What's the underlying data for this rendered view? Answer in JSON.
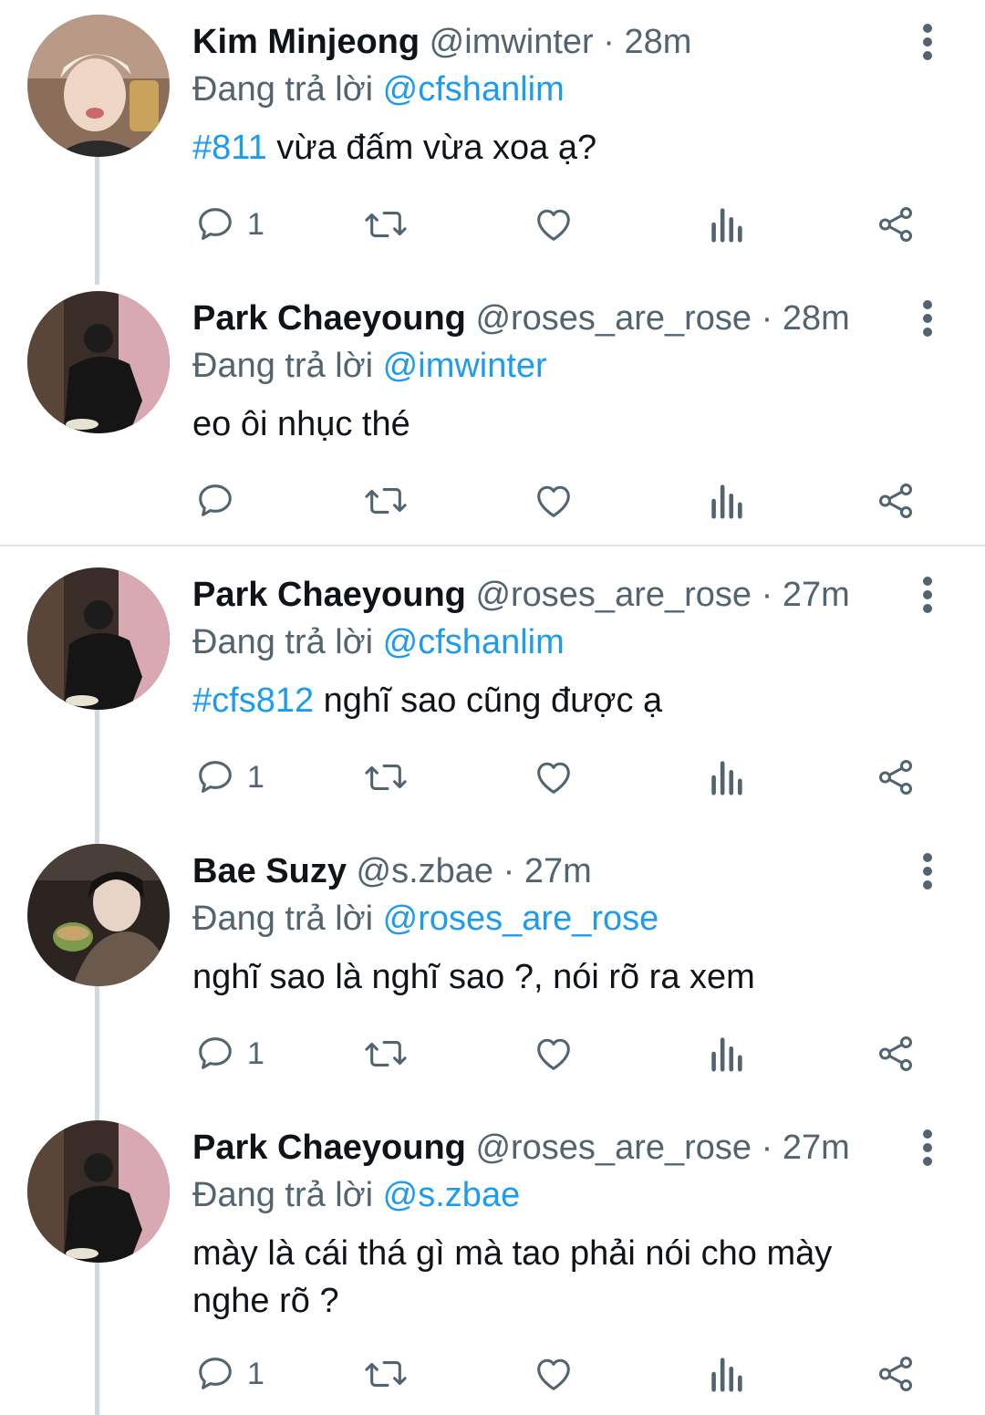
{
  "tweets": [
    {
      "name": "Kim Minjeong",
      "handle": "@imwinter",
      "time": "28m",
      "replying_prefix": "Đang trả lời",
      "replying_to": "@cfshanlim",
      "tag": "#811",
      "text": " vừa đấm vừa xoa ạ?",
      "reply_count": "1"
    },
    {
      "name": "Park Chaeyoung",
      "handle": "@roses_are_rose",
      "time": "28m",
      "replying_prefix": "Đang trả lời",
      "replying_to": "@imwinter",
      "tag": "",
      "text": "eo ôi nhục thé",
      "reply_count": ""
    },
    {
      "name": "Park Chaeyoung",
      "handle": "@roses_are_rose",
      "time": "27m",
      "replying_prefix": "Đang trả lời",
      "replying_to": "@cfshanlim",
      "tag": "#cfs812",
      "text": " nghĩ sao cũng được ạ",
      "reply_count": "1"
    },
    {
      "name": "Bae Suzy",
      "handle": "@s.zbae",
      "time": "27m",
      "replying_prefix": "Đang trả lời",
      "replying_to": "@roses_are_rose",
      "tag": "",
      "text": "nghĩ sao là nghĩ sao ?, nói rõ ra xem",
      "reply_count": "1"
    },
    {
      "name": "Park Chaeyoung",
      "handle": "@roses_are_rose",
      "time": "27m",
      "replying_prefix": "Đang trả lời",
      "replying_to": "@s.zbae",
      "tag": "",
      "text": "mày là cái thá gì mà tao phải nói cho mày nghe rõ ?",
      "reply_count": "1"
    }
  ],
  "separator": "·",
  "icons": {
    "reply": "reply-icon",
    "retweet": "retweet-icon",
    "like": "heart-icon",
    "views": "analytics-icon",
    "share": "share-icon",
    "more": "more-vertical-icon"
  },
  "colors": {
    "link": "#1d9bf0",
    "secondary": "#536471",
    "thread_line": "#cfd9de"
  }
}
